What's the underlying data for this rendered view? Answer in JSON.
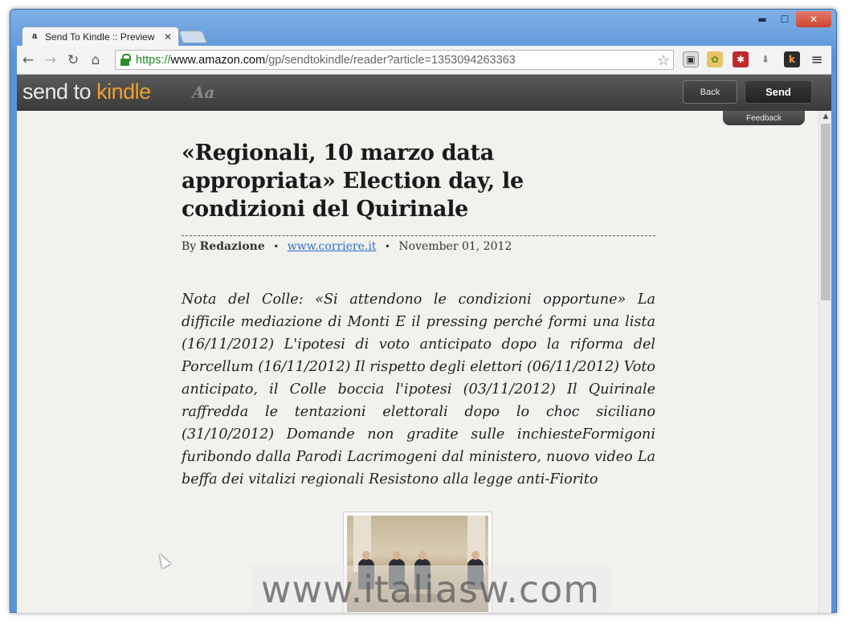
{
  "browser": {
    "tab": {
      "favicon": "a",
      "title": "Send To Kindle :: Preview",
      "close_glyph": "✕"
    },
    "window_controls": {
      "minimize": "▬",
      "maximize": "☐",
      "close": "✕"
    },
    "nav": {
      "back": "←",
      "forward": "→",
      "reload": "↻",
      "home": "⌂"
    },
    "address": {
      "scheme": "https://",
      "host": "www.amazon.com",
      "path": "/gp/sendtokindle/reader?article=1353094263363",
      "star_glyph": "☆"
    },
    "extensions": [
      "evernote-icon",
      "box-icon",
      "lastpass-icon",
      "download-icon",
      "kindle-k-icon"
    ],
    "menu_glyph": "≡"
  },
  "app": {
    "logo_send": "send to ",
    "logo_kindle": "kindle",
    "font_button": "Aa",
    "back_button": "Back",
    "send_button": "Send",
    "feedback": "Feedback"
  },
  "article": {
    "headline": "«Regionali, 10 marzo data appropriata» Election day, le condizioni del Quirinale",
    "by_prefix": "By",
    "author": "Redazione",
    "source": "www.corriere.it",
    "date": "November 01, 2012",
    "lede": "Nota del Colle: «Si attendono le condizioni opportune» La difficile mediazione di Monti E il pressing perché formi una lista (16/11/2012) L'ipotesi di voto anticipato dopo la riforma del Porcellum (16/11/2012) Il rispetto degli elettori (06/11/2012) Voto anticipato, il Colle boccia l'ipotesi (03/11/2012) Il Quirinale raffredda le tentazioni elettorali dopo lo choc siciliano (31/10/2012) Domande non gradite sulle inchiesteFormigoni furibondo dalla Parodi Lacrimogeni dal ministero, nuovo video La beffa dei vitalizi regionali Resistono alla legge anti-Fiorito"
  },
  "watermark": "www.italiasw.com",
  "colors": {
    "kindle_orange": "#f0a030",
    "link_blue": "#2a6ec9",
    "page_bg": "#f2f1ee"
  }
}
